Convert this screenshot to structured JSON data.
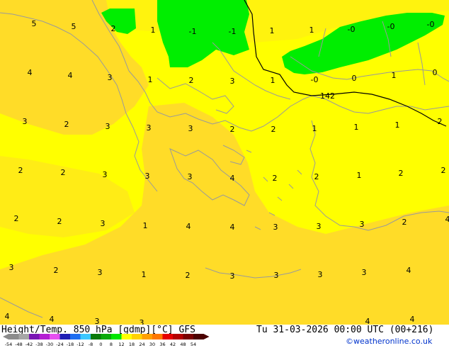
{
  "map": {
    "colors": {
      "background": "#ffff00",
      "warm_band": "#ffdc28",
      "cool_band": "#00ee00",
      "coastline": "#9a9a9a",
      "isoline": "#000000"
    },
    "temperature_labels": [
      "5",
      "5",
      "2",
      "1",
      "-1",
      "-1",
      "1",
      "1",
      "-0",
      "-0",
      "-0",
      "4",
      "4",
      "3",
      "1",
      "2",
      "3",
      "1",
      "-0",
      "0",
      "1",
      "0",
      "3",
      "2",
      "3",
      "3",
      "3",
      "2",
      "2",
      "1",
      "1",
      "1",
      "2",
      "2",
      "2",
      "3",
      "3",
      "3",
      "4",
      "2",
      "2",
      "1",
      "2",
      "2",
      "2",
      "2",
      "3",
      "1",
      "4",
      "4",
      "3",
      "3",
      "3",
      "2",
      "4",
      "3",
      "2",
      "3",
      "1",
      "2",
      "3",
      "3",
      "3",
      "3",
      "4",
      "4",
      "4",
      "3",
      "3",
      "4",
      "4"
    ],
    "height_contour_label": "142"
  },
  "footer": {
    "title": "Height/Temp. 850 hPa [gdmp][°C] GFS",
    "datetime": "Tu 31-03-2026 00:00 UTC (00+216)",
    "credit": "©weatheronline.co.uk",
    "scale_labels": [
      "-54",
      "-48",
      "-42",
      "-38",
      "-30",
      "-24",
      "-18",
      "-12",
      "-8",
      "0",
      "8",
      "12",
      "18",
      "24",
      "30",
      "36",
      "42",
      "48",
      "54"
    ],
    "scale_colors": [
      "#8c8c8c",
      "#a6a6a6",
      "#7a16b4",
      "#b41ed2",
      "#e650f0",
      "#1e1eb4",
      "#1e6ef0",
      "#3cc8ff",
      "#0a7a0a",
      "#0aaa0a",
      "#00e600",
      "#ffff00",
      "#ffd200",
      "#ffa000",
      "#ff7800",
      "#e60000",
      "#b40000",
      "#7a0000",
      "#4b0000"
    ]
  }
}
